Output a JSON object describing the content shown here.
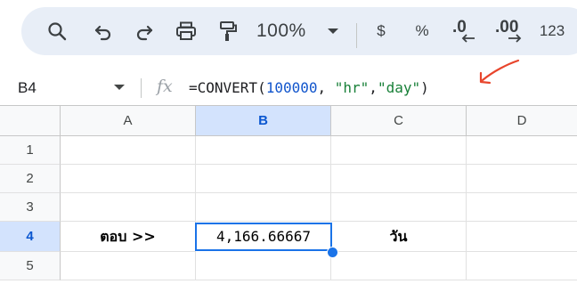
{
  "toolbar": {
    "zoom": "100%",
    "currency": "$",
    "percent": "%",
    "decrease_decimal": ".0",
    "increase_decimal": ".00",
    "number_format": "123"
  },
  "formula_bar": {
    "cell_ref": "B4",
    "fx_label": "fx",
    "formula": {
      "prefix": "=CONVERT(",
      "number": "100000",
      "sep1": ", ",
      "arg2": "\"hr\"",
      "sep2": ",",
      "arg3": "\"day\"",
      "suffix": ")"
    }
  },
  "grid": {
    "columns": [
      "A",
      "B",
      "C",
      "D"
    ],
    "selected_column": "B",
    "rows": [
      "1",
      "2",
      "3",
      "4",
      "5"
    ],
    "selected_row": "4",
    "cells": {
      "A4": "ตอบ >>",
      "B4": "4,166.66667",
      "C4": "วัน"
    }
  },
  "colors": {
    "accent": "#1a73e8",
    "selected_header_bg": "#d3e3fd",
    "annotation": "#e8452c"
  },
  "icons": [
    "search-icon",
    "undo-icon",
    "redo-icon",
    "print-icon",
    "paint-format-icon",
    "zoom-dropdown-icon",
    "namebox-dropdown-icon"
  ]
}
